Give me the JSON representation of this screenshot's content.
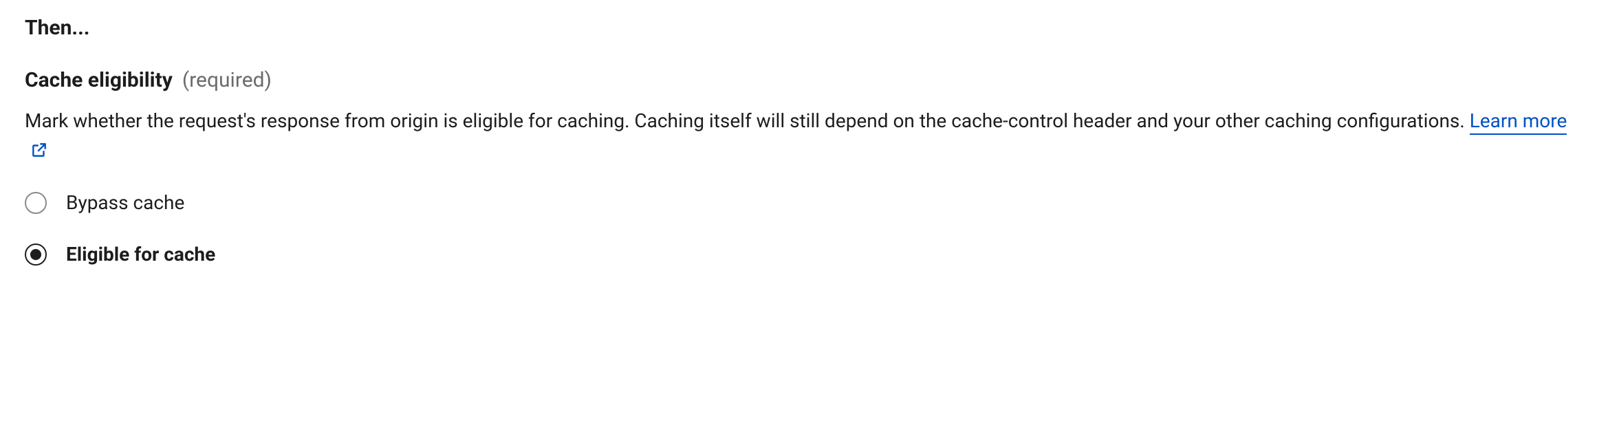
{
  "section": {
    "header": "Then..."
  },
  "field": {
    "label": "Cache eligibility",
    "required_tag": "(required)",
    "description_part1": "Mark whether the request's response from origin is eligible for caching. Caching itself will still depend on the cache-control header and your other caching configurations. ",
    "learn_more": "Learn more"
  },
  "radio": {
    "options": [
      {
        "label": "Bypass cache",
        "selected": false
      },
      {
        "label": "Eligible for cache",
        "selected": true
      }
    ]
  }
}
